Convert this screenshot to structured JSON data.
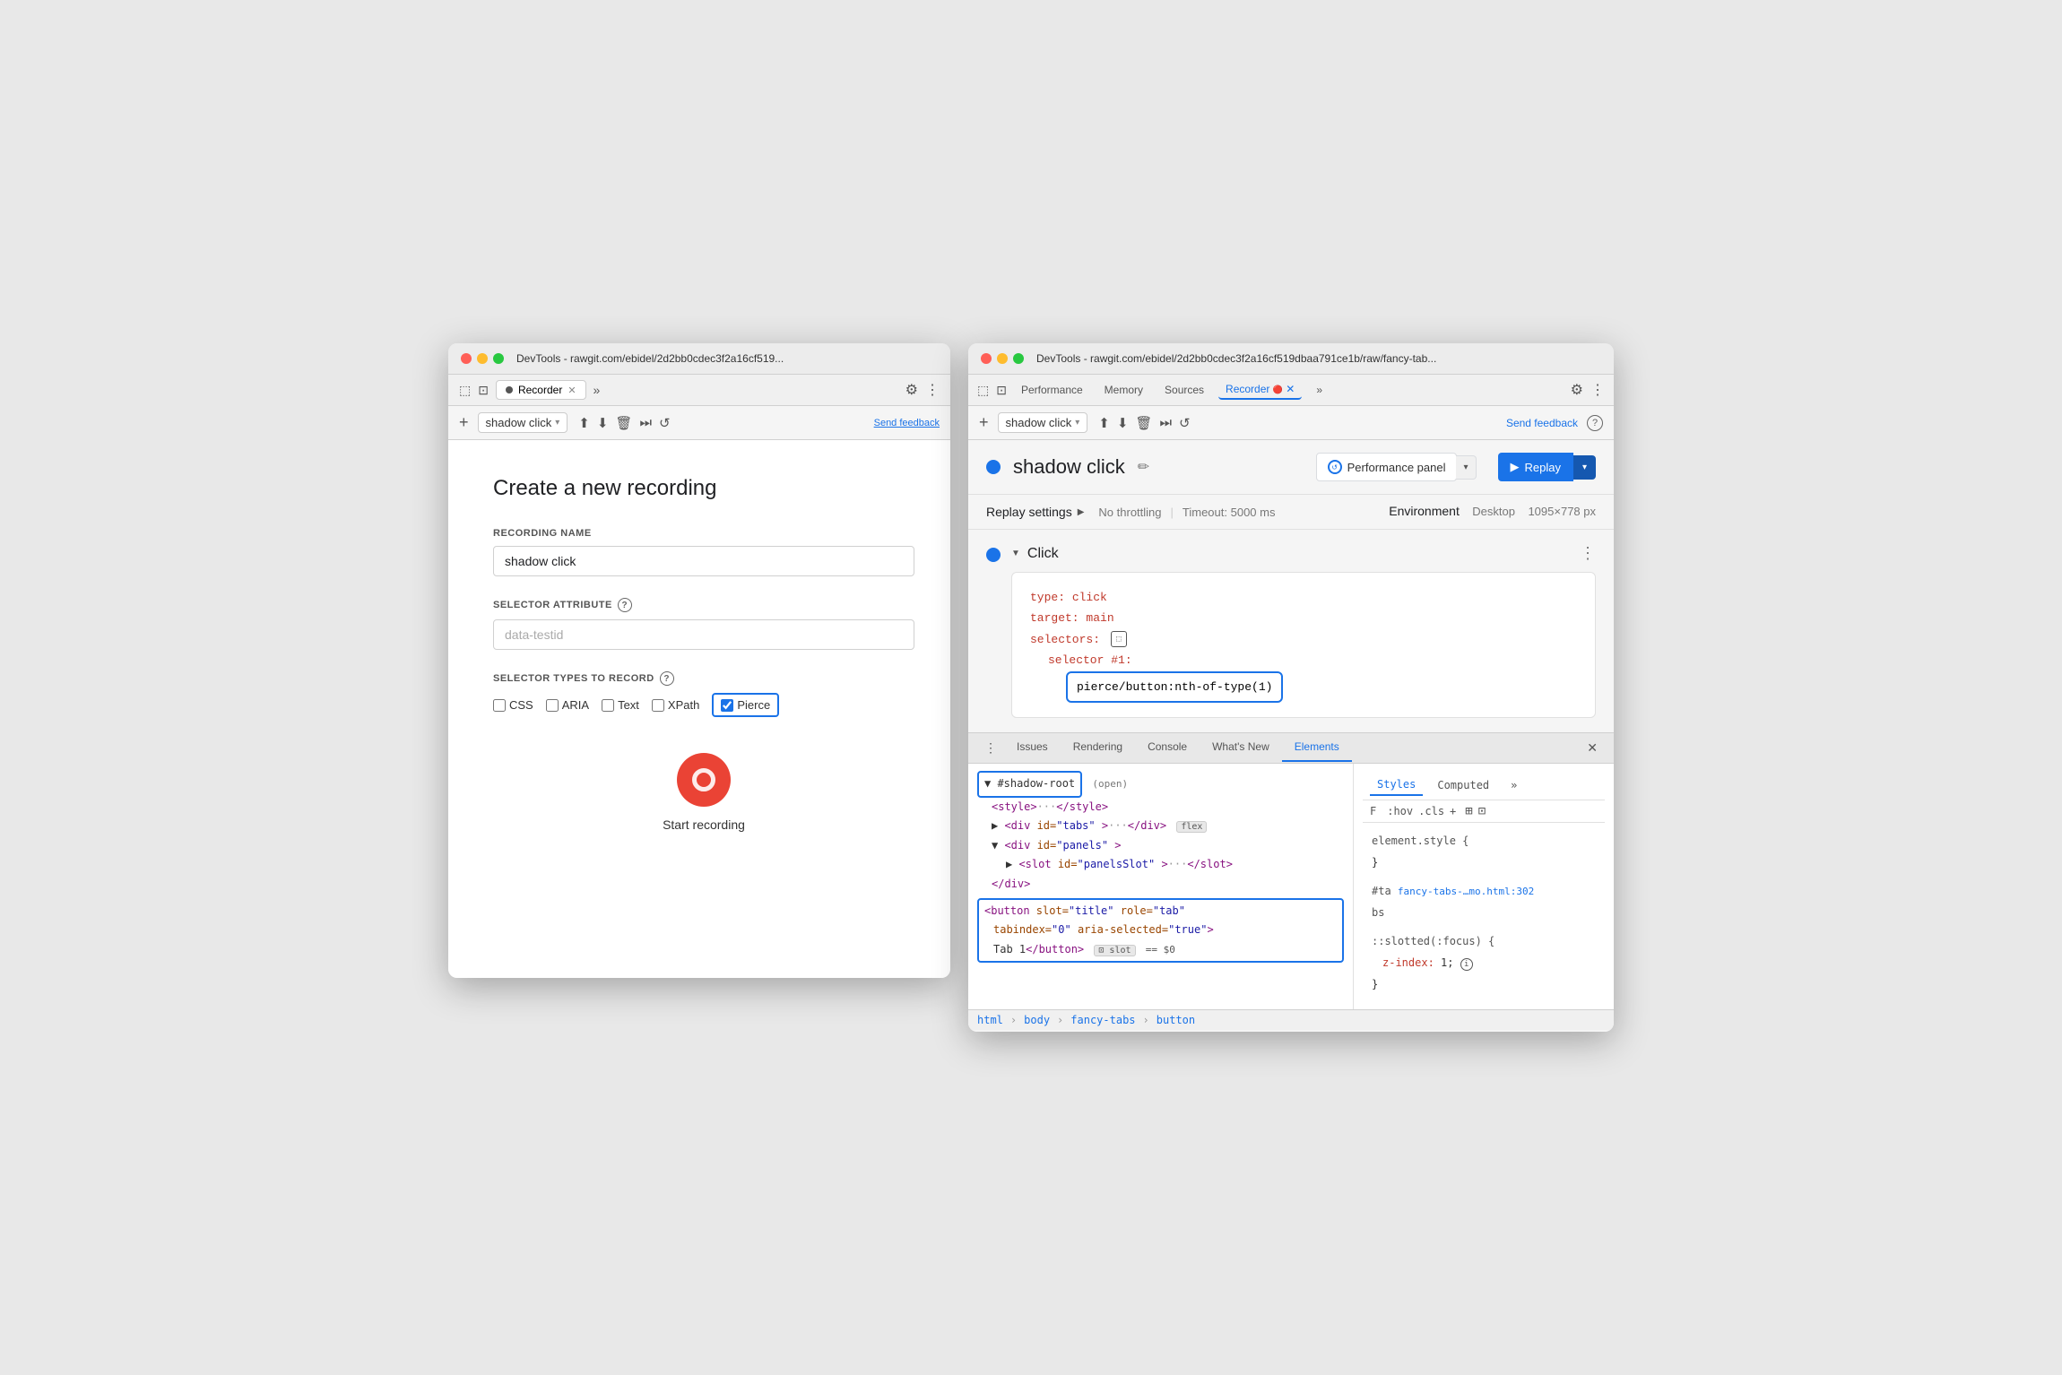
{
  "left_window": {
    "title": "DevTools - rawgit.com/ebidel/2d2bb0cdec3f2a16cf519...",
    "tab_label": "Recorder",
    "tab_has_dot": true,
    "toolbar": {
      "add_btn": "+",
      "recording_name": "shadow click",
      "send_feedback": "Send feedback"
    },
    "form": {
      "title": "Create a new recording",
      "recording_name_label": "RECORDING NAME",
      "recording_name_value": "shadow click",
      "selector_attribute_label": "SELECTOR ATTRIBUTE",
      "selector_attribute_placeholder": "data-testid",
      "selector_types_label": "SELECTOR TYPES TO RECORD",
      "checkboxes": [
        {
          "label": "CSS",
          "checked": false
        },
        {
          "label": "ARIA",
          "checked": false
        },
        {
          "label": "Text",
          "checked": false
        },
        {
          "label": "XPath",
          "checked": false
        },
        {
          "label": "Pierce",
          "checked": true
        }
      ],
      "start_recording_label": "Start recording"
    }
  },
  "right_window": {
    "title": "DevTools - rawgit.com/ebidel/2d2bb0cdec3f2a16cf519dbaa791ce1b/raw/fancy-tab...",
    "tabs": [
      "Performance",
      "Memory",
      "Sources",
      "Recorder",
      "»"
    ],
    "active_tab": "Recorder",
    "toolbar": {
      "add_btn": "+",
      "recording_name": "shadow click",
      "send_feedback": "Send feedback"
    },
    "recording_header": {
      "name": "shadow click",
      "perf_panel_btn": "Performance panel",
      "replay_btn": "Replay"
    },
    "replay_settings": {
      "label": "Replay settings",
      "throttling": "No throttling",
      "timeout": "Timeout: 5000 ms",
      "env_label": "Environment",
      "env_value": "Desktop",
      "env_size": "1095×778 px"
    },
    "step": {
      "title": "Click",
      "code": {
        "type_key": "type:",
        "type_val": "click",
        "target_key": "target:",
        "target_val": "main",
        "selectors_key": "selectors:",
        "selector_num_key": "selector #1:",
        "selector_val": "pierce/button:nth-of-type(1)"
      }
    },
    "bottom_tabs": [
      "Issues",
      "Rendering",
      "Console",
      "What's New",
      "Elements"
    ],
    "active_bottom_tab": "Elements",
    "elements": {
      "lines": [
        {
          "text": "▼ #shadow-root",
          "highlight": true,
          "bordered": true
        },
        {
          "text": "  <style>···</style>"
        },
        {
          "text": "  ▶ <div id=\"tabs\">···</div>",
          "badge": "flex"
        },
        {
          "text": "  ▼ <div id=\"panels\">"
        },
        {
          "text": "    ▶ <slot id=\"panelsSlot\">···</slot>"
        },
        {
          "text": "    </div>"
        },
        {
          "text": "  </div>",
          "highlighted_line": true
        }
      ],
      "highlighted_button_text": "<button slot=\"title\" role=\"tab\" tabindex=\"0\" aria-selected=\"true\">Tab 1</button>",
      "slot_badge": "slot",
      "dollar_badge": "== $0"
    },
    "styles": {
      "tabs": [
        "Styles",
        "Computed",
        "»"
      ],
      "active_tab": "Styles",
      "filter_placeholder": "F  :hov  .cls  +",
      "rules": [
        {
          "selector": "element.style {",
          "props": [],
          "close": "}"
        },
        {
          "selector": "#ta  fancy-tabs-…mo.html:302 bs",
          "props": []
        },
        {
          "selector": "::slotted(:focus) {",
          "props": [
            {
              "prop": "z-index:",
              "val": "1;"
            }
          ],
          "close": "}"
        }
      ]
    },
    "breadcrumb": [
      "html",
      "body",
      "fancy-tabs",
      "button"
    ]
  }
}
